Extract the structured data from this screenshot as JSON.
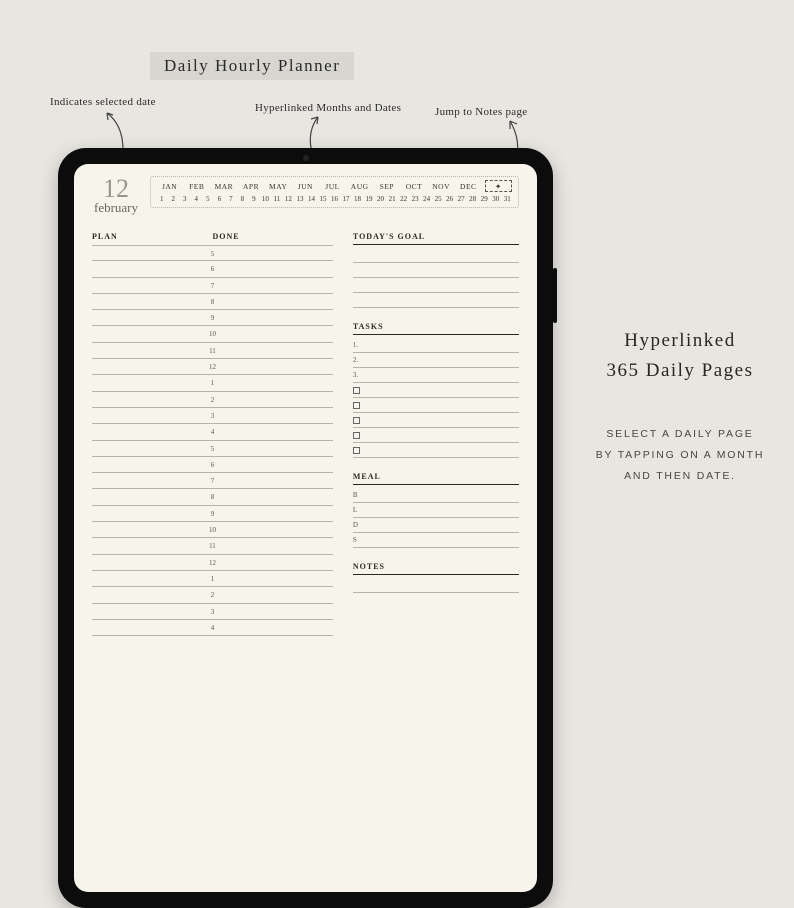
{
  "title": "Daily Hourly Planner",
  "annotations": {
    "selected_date": "Indicates selected date",
    "hyperlinked": "Hyperlinked Months and Dates",
    "jump_notes": "Jump to Notes page"
  },
  "date": {
    "day": "12",
    "month": "february"
  },
  "months": [
    "JAN",
    "FEB",
    "MAR",
    "APR",
    "MAY",
    "JUN",
    "JUL",
    "AUG",
    "SEP",
    "OCT",
    "NOV",
    "DEC"
  ],
  "dates": [
    "1",
    "2",
    "3",
    "4",
    "5",
    "6",
    "7",
    "8",
    "9",
    "10",
    "11",
    "12",
    "13",
    "14",
    "15",
    "16",
    "17",
    "18",
    "19",
    "20",
    "21",
    "22",
    "23",
    "24",
    "25",
    "26",
    "27",
    "28",
    "29",
    "30",
    "31"
  ],
  "headers": {
    "plan": "PLAN",
    "done": "DONE",
    "goal": "TODAY'S GOAL",
    "tasks": "TASKS",
    "meal": "MEAL",
    "notes": "NOTES"
  },
  "hours": [
    "5",
    "6",
    "7",
    "8",
    "9",
    "10",
    "11",
    "12",
    "1",
    "2",
    "3",
    "4",
    "5",
    "6",
    "7",
    "8",
    "9",
    "10",
    "11",
    "12",
    "1",
    "2",
    "3",
    "4"
  ],
  "task_nums": [
    "1.",
    "2.",
    "3."
  ],
  "meal_labels": [
    "B",
    "L",
    "D",
    "S"
  ],
  "side": {
    "line1": "Hyperlinked",
    "line2": "365 Daily Pages",
    "desc1": "SELECT A DAILY PAGE",
    "desc2": "BY TAPPING ON A MONTH",
    "desc3": "AND THEN DATE."
  },
  "notes_jump_glyph": "✦"
}
